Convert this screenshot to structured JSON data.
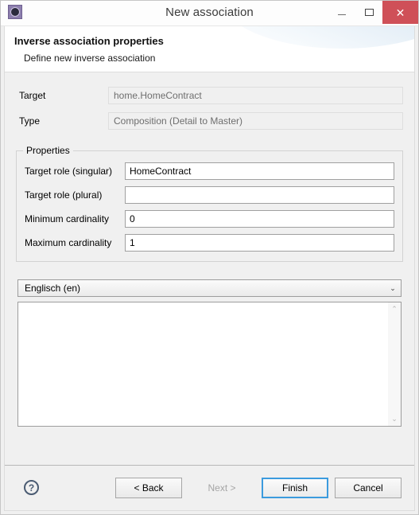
{
  "window": {
    "title": "New association",
    "icon": "association-gear-icon",
    "controls": {
      "minimize": "minimize-icon",
      "maximize": "maximize-icon",
      "close": "close-icon",
      "close_glyph": "✕",
      "minimize_glyph": "",
      "close_bg": "#cf5058"
    }
  },
  "header": {
    "title": "Inverse association properties",
    "subtitle": "Define new inverse association"
  },
  "top_fields": [
    {
      "label": "Target",
      "value": "home.HomeContract",
      "readonly": true
    },
    {
      "label": "Type",
      "value": "Composition (Detail to Master)",
      "readonly": true
    }
  ],
  "properties_group": {
    "legend": "Properties",
    "fields": [
      {
        "label": "Target role (singular)",
        "value": "HomeContract",
        "placeholder": ""
      },
      {
        "label": "Target role (plural)",
        "value": "",
        "placeholder": ""
      },
      {
        "label": "Minimum cardinality",
        "value": "0",
        "placeholder": ""
      },
      {
        "label": "Maximum cardinality",
        "value": "1",
        "placeholder": ""
      }
    ]
  },
  "language_select": {
    "selected": "Englisch (en)",
    "arrow": "⌄",
    "options": [
      "Englisch (en)"
    ]
  },
  "description": {
    "value": "",
    "placeholder": ""
  },
  "scrollbar": {
    "up_arrow": "⌃",
    "down_arrow": "⌄"
  },
  "buttons": {
    "help": "?",
    "back": "< Back",
    "next": "Next >",
    "finish": "Finish",
    "cancel": "Cancel",
    "focus_color": "#3c9bde"
  }
}
